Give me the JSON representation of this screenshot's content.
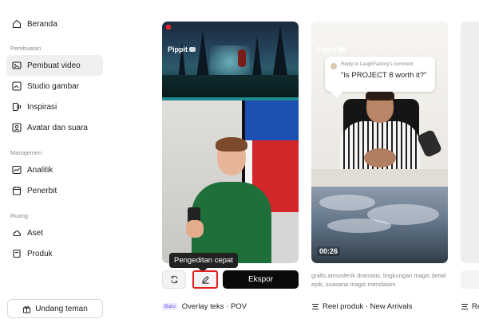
{
  "sidebar": {
    "items": [
      {
        "label": "Beranda",
        "icon": "home-icon"
      },
      {
        "label": "Pembuat video",
        "icon": "video-icon",
        "active": true
      },
      {
        "label": "Studio gambar",
        "icon": "image-edit-icon"
      },
      {
        "label": "Inspirasi",
        "icon": "inspiration-icon"
      },
      {
        "label": "Avatar dan suara",
        "icon": "avatar-icon"
      },
      {
        "label": "Analitik",
        "icon": "analytics-icon"
      },
      {
        "label": "Penerbit",
        "icon": "calendar-icon"
      },
      {
        "label": "Aset",
        "icon": "cloud-icon"
      },
      {
        "label": "Produk",
        "icon": "product-icon"
      }
    ],
    "sections": {
      "creation": "Pembuatan",
      "management": "Manajemen",
      "space": "Ruang"
    },
    "invite_label": "Undang teman"
  },
  "cards": [
    {
      "brand": "Pippit",
      "caption": "",
      "badge": "Baru",
      "title": "Overlay teks · POV",
      "tooltip": "Pengeditan cepat",
      "export_label": "Ekspor"
    },
    {
      "brand": "Pippit",
      "reply_label": "Reply to LaughFactory's comment",
      "quote": "\"Is PROJECT 8 worth it?\"",
      "duration": "00:26",
      "description": "grafis atmosferik dramatis, lingkungan magis detail epik, suasana magis mendalam",
      "title": "Reel produk · New Arrivals"
    },
    {
      "title_partial": "Re"
    }
  ],
  "colors": {
    "export_bg": "#0a0a0a",
    "highlight": "#e0201e",
    "badge_text": "#6b4fe0",
    "active_bg": "#efeff0"
  }
}
